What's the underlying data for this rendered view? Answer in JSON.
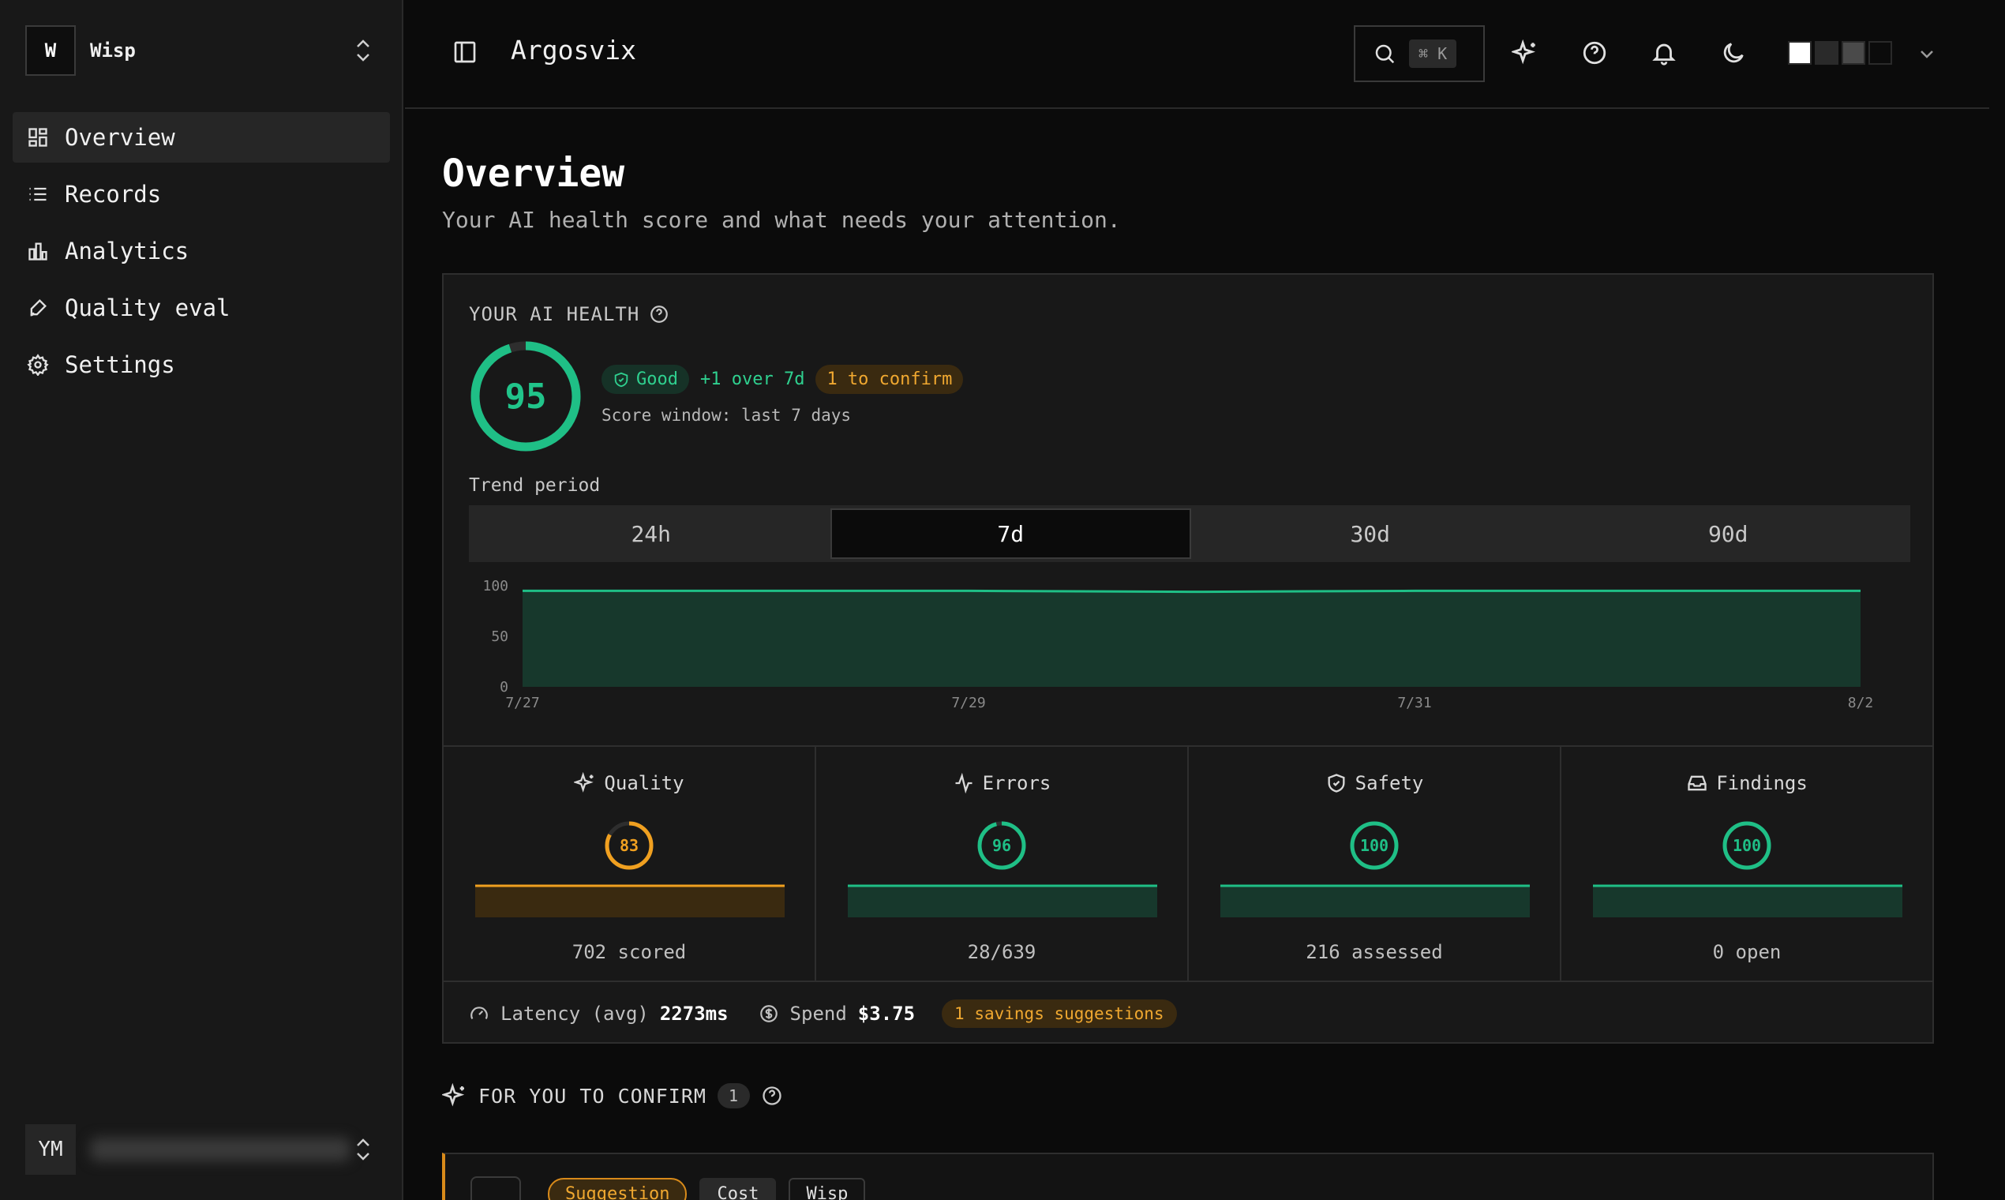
{
  "workspace": {
    "initial": "W",
    "name": "Wisp"
  },
  "sidebar": {
    "items": [
      {
        "label": "Overview",
        "icon": "dashboard-icon"
      },
      {
        "label": "Records",
        "icon": "list-icon"
      },
      {
        "label": "Analytics",
        "icon": "bar-chart-icon"
      },
      {
        "label": "Quality eval",
        "icon": "brush-icon"
      },
      {
        "label": "Settings",
        "icon": "gear-icon"
      }
    ]
  },
  "user": {
    "initials": "YM",
    "email": ""
  },
  "header": {
    "title": "Argosvix",
    "search_shortcut": "⌘ K",
    "theme_swatches": [
      "#ffffff",
      "#2a2a2a",
      "#4a4a4a",
      "#0b0b0b"
    ]
  },
  "page": {
    "title": "Overview",
    "subtitle": "Your AI health score and what needs your attention."
  },
  "health": {
    "label": "YOUR AI HEALTH",
    "score": "95",
    "score_fraction": 0.95,
    "status": "Good",
    "delta": "+1 over 7d",
    "confirm": "1 to confirm",
    "window": "Score window: last 7 days",
    "trend_label": "Trend period",
    "tabs": [
      "24h",
      "7d",
      "30d",
      "90d"
    ],
    "active_tab": "7d"
  },
  "chart_data": {
    "type": "area",
    "x": [
      "7/27",
      "7/28",
      "7/29",
      "7/30",
      "7/31",
      "8/1",
      "8/2"
    ],
    "values": [
      95,
      95,
      95,
      94,
      95,
      95,
      95
    ],
    "x_ticks": [
      "7/27",
      "7/29",
      "7/31",
      "8/2"
    ],
    "y_ticks": [
      "100",
      "50",
      "0"
    ],
    "ylim": [
      0,
      100
    ],
    "color": "#1fbf86"
  },
  "metrics": [
    {
      "title": "Quality",
      "icon": "sparkle-icon",
      "value": "83",
      "fraction": 0.83,
      "color": "#f0a020",
      "footer": "702 scored"
    },
    {
      "title": "Errors",
      "icon": "activity-icon",
      "value": "96",
      "fraction": 0.96,
      "color": "#1fbf86",
      "footer": "28/639"
    },
    {
      "title": "Safety",
      "icon": "shield-icon",
      "value": "100",
      "fraction": 1.0,
      "color": "#1fbf86",
      "footer": "216 assessed"
    },
    {
      "title": "Findings",
      "icon": "inbox-icon",
      "value": "100",
      "fraction": 1.0,
      "color": "#1fbf86",
      "footer": "0 open"
    }
  ],
  "footer": {
    "latency_label": "Latency (avg)",
    "latency_value": "2273ms",
    "spend_label": "Spend",
    "spend_value": "$3.75",
    "savings": "1 savings suggestions"
  },
  "confirm_section": {
    "title": "FOR YOU TO CONFIRM",
    "count": "1",
    "tags": [
      "Suggestion",
      "Cost",
      "Wisp"
    ]
  }
}
